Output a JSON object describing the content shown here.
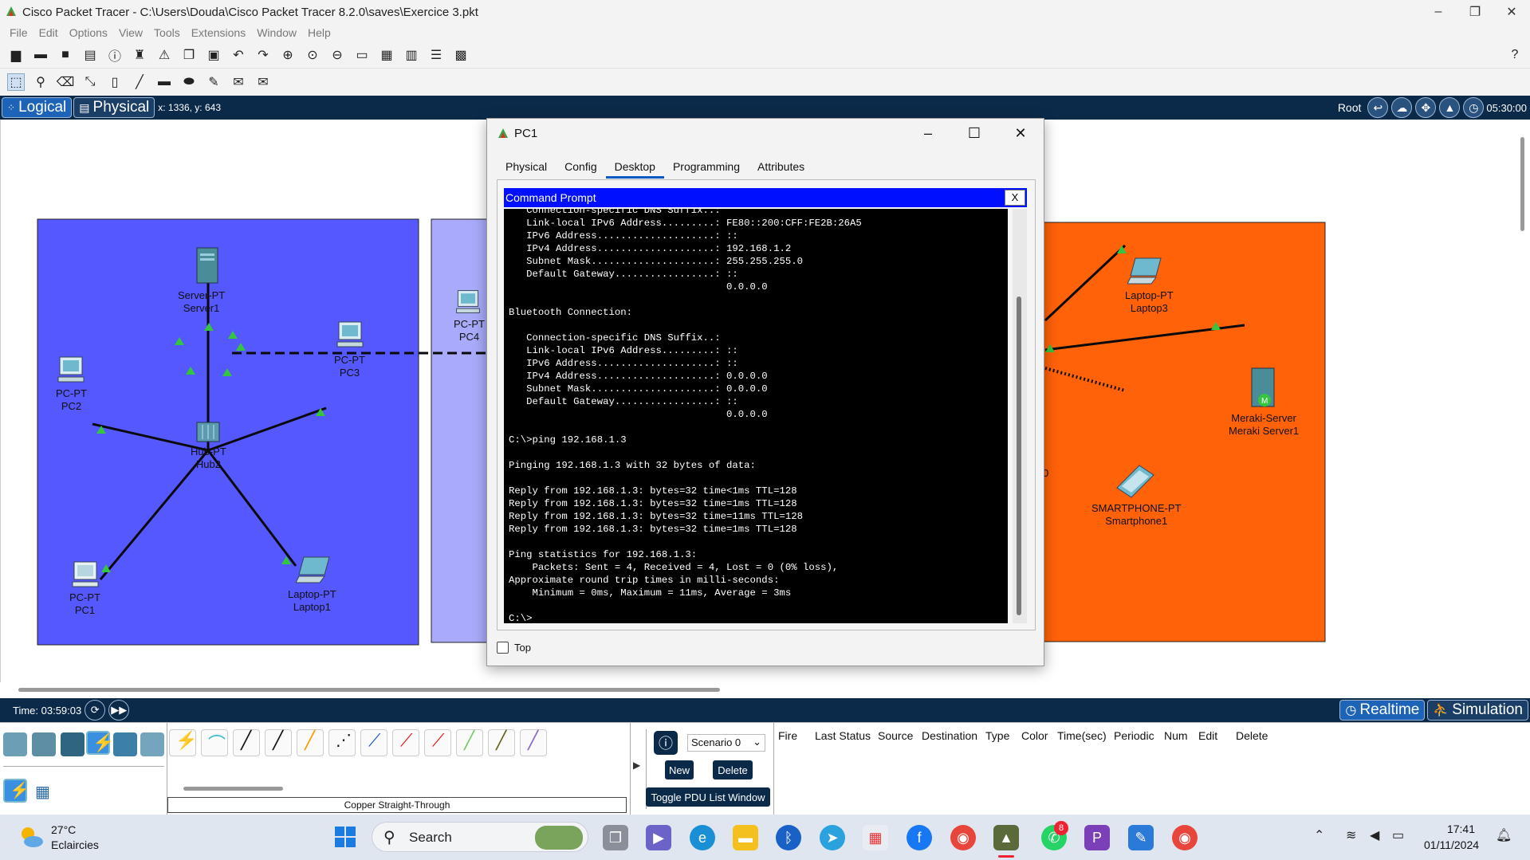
{
  "window": {
    "title": "Cisco Packet Tracer - C:\\Users\\Douda\\Cisco Packet Tracer 8.2.0\\saves\\Exercice 3.pkt",
    "controls": [
      "–",
      "❐",
      "✕"
    ]
  },
  "menu": [
    "File",
    "Edit",
    "Options",
    "View",
    "Tools",
    "Extensions",
    "Window",
    "Help"
  ],
  "workspace": {
    "logical_label": "Logical",
    "physical_label": "Physical",
    "coords": "x: 1336, y: 643",
    "root_label": "Root",
    "clock": "05:30:00"
  },
  "topology": {
    "devices": [
      {
        "type": "Server-PT",
        "name": "Server1"
      },
      {
        "type": "PC-PT",
        "name": "PC3"
      },
      {
        "type": "PC-PT",
        "name": "PC2"
      },
      {
        "type": "Hub-PT",
        "name": "Hub2"
      },
      {
        "type": "PC-PT",
        "name": "PC1"
      },
      {
        "type": "Laptop-PT",
        "name": "Laptop1"
      },
      {
        "type": "PC-PT",
        "name": "PC4"
      },
      {
        "type": "Laptop-PT",
        "name": "Laptop3"
      },
      {
        "type": "Meraki-Server",
        "name": "Meraki Server1"
      },
      {
        "type": "SMARTPHONE-PT",
        "name": "Smartphone1"
      }
    ],
    "partial_label": "0",
    "colors": {
      "area_blue": "#5557ff",
      "area_lilac": "#a9abfa",
      "area_orange": "#ff6209"
    }
  },
  "dialog": {
    "title": "PC1",
    "tabs": [
      "Physical",
      "Config",
      "Desktop",
      "Programming",
      "Attributes"
    ],
    "active_tab": "Desktop",
    "cmd_title": "Command Prompt",
    "cmd_close": "X",
    "terminal_lines": [
      "   Connection-specific DNS Suffix..: ",
      "   Link-local IPv6 Address.........: FE80::200:CFF:FE2B:26A5",
      "   IPv6 Address....................: ::",
      "   IPv4 Address....................: 192.168.1.2",
      "   Subnet Mask.....................: 255.255.255.0",
      "   Default Gateway.................: ::",
      "                                     0.0.0.0",
      "",
      "Bluetooth Connection:",
      "",
      "   Connection-specific DNS Suffix..: ",
      "   Link-local IPv6 Address.........: ::",
      "   IPv6 Address....................: ::",
      "   IPv4 Address....................: 0.0.0.0",
      "   Subnet Mask.....................: 0.0.0.0",
      "   Default Gateway.................: ::",
      "                                     0.0.0.0",
      "",
      "C:\\>ping 192.168.1.3",
      "",
      "Pinging 192.168.1.3 with 32 bytes of data:",
      "",
      "Reply from 192.168.1.3: bytes=32 time<1ms TTL=128",
      "Reply from 192.168.1.3: bytes=32 time=1ms TTL=128",
      "Reply from 192.168.1.3: bytes=32 time=11ms TTL=128",
      "Reply from 192.168.1.3: bytes=32 time=1ms TTL=128",
      "",
      "Ping statistics for 192.168.1.3:",
      "    Packets: Sent = 4, Received = 4, Lost = 0 (0% loss),",
      "Approximate round trip times in milli-seconds:",
      "    Minimum = 0ms, Maximum = 11ms, Average = 3ms",
      "",
      "C:\\>"
    ],
    "top_checkbox_label": "Top"
  },
  "bottom": {
    "time": "Time: 03:59:03",
    "realtime_label": "Realtime",
    "simulation_label": "Simulation",
    "cable_description": "Copper Straight-Through",
    "scenario": "Scenario 0",
    "new_label": "New",
    "delete_label": "Delete",
    "toggle_label": "Toggle PDU List Window",
    "pdu_columns": [
      "Fire",
      "Last Status",
      "Source",
      "Destination",
      "Type",
      "Color",
      "Time(sec)",
      "Periodic",
      "Num",
      "Edit",
      "Delete"
    ]
  },
  "taskbar": {
    "weather_temp": "27°C",
    "weather_desc": "Eclaircies",
    "search_label": "Search",
    "time": "17:41",
    "date": "01/11/2024",
    "whatsapp_badge": "8"
  }
}
